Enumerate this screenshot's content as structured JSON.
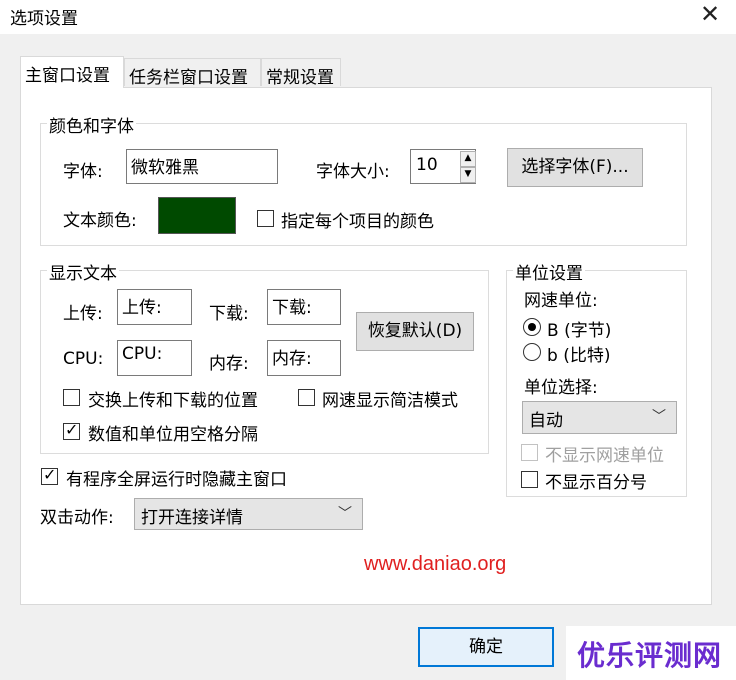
{
  "window": {
    "title": "选项设置"
  },
  "tabs": [
    {
      "label": "主窗口设置",
      "active": true
    },
    {
      "label": "任务栏窗口设置",
      "active": false
    },
    {
      "label": "常规设置",
      "active": false
    }
  ],
  "color_font": {
    "legend": "颜色和字体",
    "font_label": "字体:",
    "font_value": "微软雅黑",
    "size_label": "字体大小:",
    "size_value": "10",
    "choose_font_button": "选择字体(F)...",
    "text_color_label": "文本颜色:",
    "text_color": "#004a00",
    "per_item_color_label": "指定每个项目的颜色",
    "per_item_color_checked": false
  },
  "display_text": {
    "legend": "显示文本",
    "upload_label": "上传:",
    "upload_value": "上传:",
    "download_label": "下载:",
    "download_value": "下载:",
    "cpu_label": "CPU:",
    "cpu_value": "CPU:",
    "memory_label": "内存:",
    "memory_value": "内存:",
    "restore_button": "恢复默认(D)",
    "swap_label": "交换上传和下载的位置",
    "swap_checked": false,
    "simple_mode_label": "网速显示简洁模式",
    "simple_mode_checked": false,
    "space_label": "数值和单位用空格分隔",
    "space_checked": true
  },
  "unit_settings": {
    "legend": "单位设置",
    "speed_unit_label": "网速单位:",
    "radio_bytes": "B (字节)",
    "radio_bits": "b (比特)",
    "selected_unit": "bytes",
    "unit_select_label": "单位选择:",
    "unit_select_value": "自动",
    "hide_unit_label": "不显示网速单位",
    "hide_unit_enabled": false,
    "hide_percent_label": "不显示百分号",
    "hide_percent_checked": false
  },
  "fullscreen_hide_label": "有程序全屏运行时隐藏主窗口",
  "fullscreen_hide_checked": true,
  "double_click": {
    "label": "双击动作:",
    "value": "打开连接详情"
  },
  "website": "www.daniao.org",
  "ok_button": "确定",
  "watermark": "优乐评测网"
}
